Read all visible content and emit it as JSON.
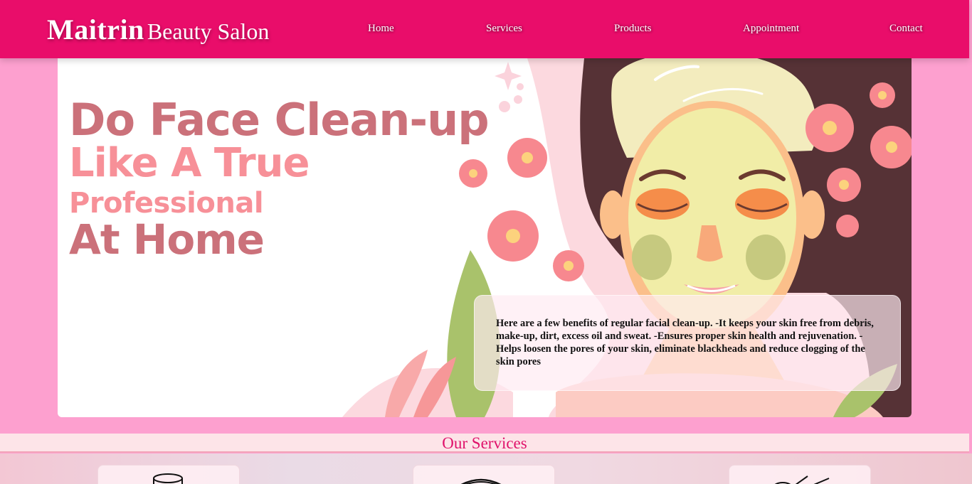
{
  "header": {
    "brand_strong": "Maitrin",
    "brand_light": "Beauty Salon",
    "nav": [
      "Home",
      "Services",
      "Products",
      "Appointment",
      "Contact"
    ]
  },
  "hero": {
    "headline": [
      "Do Face Clean-up",
      "Like A True",
      "Professional",
      "At Home"
    ],
    "info": "Here are a few benefits of regular facial clean-up. -It keeps your skin free from debris, make-up, dirt, excess oil and sweat. -Ensures proper skin health and rejuvenation. -Helps loosen the pores of your skin, eliminate blackheads and reduce clogging of the skin pores"
  },
  "services": {
    "title": "Our Services"
  },
  "colors": {
    "header_bg": "#e90d6a",
    "page_bg": "#fda0cf",
    "headline_dark": "#cb717a",
    "headline_light": "#f79098"
  }
}
